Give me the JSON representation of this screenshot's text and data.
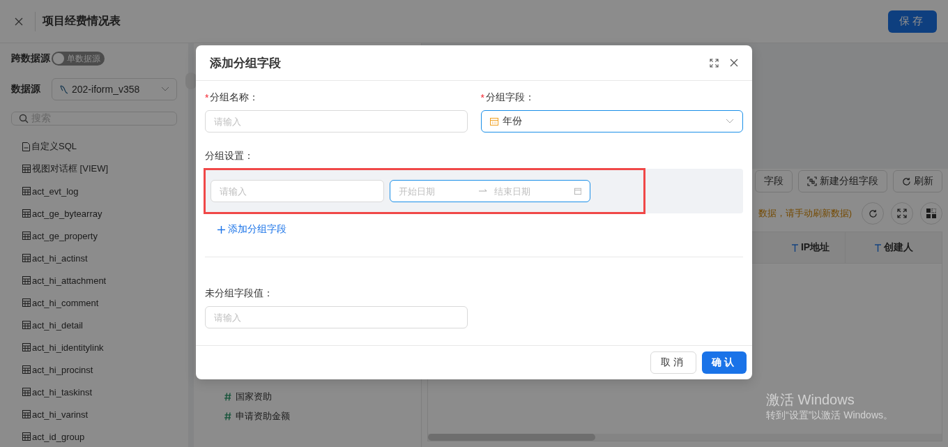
{
  "page": {
    "title": "项目经费情况表",
    "save_button": "保存"
  },
  "sidebar": {
    "cross_source_label": "跨数据源",
    "switch": {
      "label": "单数据源",
      "on": false
    },
    "datasource_label": "数据源",
    "datasource": "202-iform_v358",
    "search_placeholder": "搜索",
    "items": [
      {
        "label": "自定义SQL",
        "kind": "sql"
      },
      {
        "label": "视图对话框 [VIEW]",
        "kind": "table"
      },
      {
        "label": "act_evt_log",
        "kind": "table"
      },
      {
        "label": "act_ge_bytearray",
        "kind": "table"
      },
      {
        "label": "act_ge_property",
        "kind": "table"
      },
      {
        "label": "act_hi_actinst",
        "kind": "table"
      },
      {
        "label": "act_hi_attachment",
        "kind": "table"
      },
      {
        "label": "act_hi_comment",
        "kind": "table"
      },
      {
        "label": "act_hi_detail",
        "kind": "table"
      },
      {
        "label": "act_hi_identitylink",
        "kind": "table"
      },
      {
        "label": "act_hi_procinst",
        "kind": "table"
      },
      {
        "label": "act_hi_taskinst",
        "kind": "table"
      },
      {
        "label": "act_hi_varinst",
        "kind": "table"
      },
      {
        "label": "act_id_group",
        "kind": "table"
      }
    ]
  },
  "fields_panel": {
    "fields": [
      {
        "name": "国家资助"
      },
      {
        "name": "申请资助金额"
      }
    ]
  },
  "main": {
    "toolbar": [
      {
        "label": "字段",
        "kind": "plain"
      },
      {
        "label": "新建分组字段",
        "kind": "group"
      },
      {
        "label": "刷新",
        "kind": "refresh"
      }
    ],
    "notice": "数据，请手动刷新数据)",
    "columns": [
      {
        "label": "IP地址"
      },
      {
        "label": "创建人"
      }
    ]
  },
  "os_notice": {
    "title": "激活 Windows",
    "subtitle": "转到“设置”以激活 Windows。"
  },
  "dialog": {
    "title": "添加分组字段",
    "group_name": {
      "label": "分组名称：",
      "required_mark": "*",
      "placeholder": "请输入"
    },
    "group_field": {
      "label": "分组字段：",
      "required_mark": "*",
      "value": "年份"
    },
    "group_settings_label": "分组设置：",
    "group_rows": [
      {
        "placeholder": "请输入",
        "start_placeholder": "开始日期",
        "end_placeholder": "结束日期"
      }
    ],
    "add_link": "添加分组字段",
    "ungrouped": {
      "label": "未分组字段值：",
      "placeholder": "请输入"
    },
    "buttons": [
      {
        "label": "取消",
        "kind": "default"
      },
      {
        "label": "确认",
        "kind": "primary"
      }
    ]
  }
}
